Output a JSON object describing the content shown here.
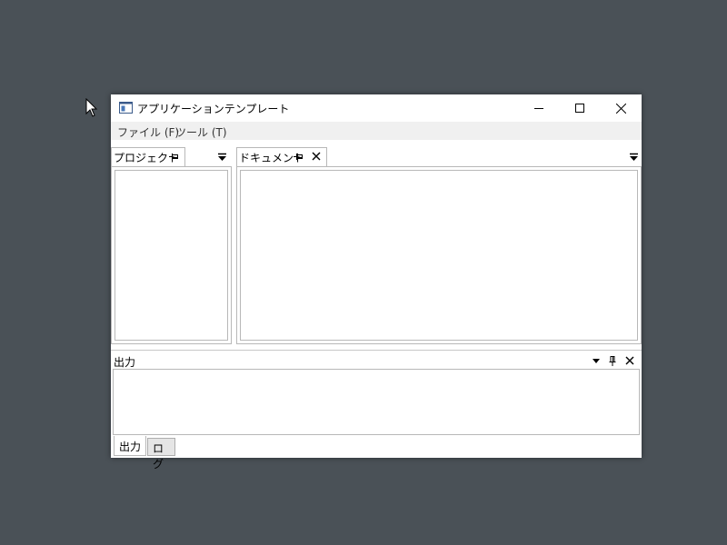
{
  "window": {
    "title": "アプリケーションテンプレート",
    "controls": {
      "minimize": "minimize-icon",
      "maximize": "maximize-icon",
      "close": "close-icon"
    }
  },
  "menubar": {
    "items": [
      {
        "label": "ファイル (F)"
      },
      {
        "label": "ツール (T)"
      }
    ]
  },
  "panes": {
    "project": {
      "tab_label": "プロジェクト",
      "icons": [
        "pin-icon",
        "dropdown-icon"
      ]
    },
    "document": {
      "tab_label": "ドキュメント",
      "icons": [
        "pin-icon",
        "close-icon",
        "dropdown-icon"
      ]
    },
    "output": {
      "title": "出力",
      "icons": [
        "dropdown-icon",
        "pin-icon",
        "close-icon"
      ]
    }
  },
  "bottom_tabs": [
    {
      "label": "出力",
      "active": true
    },
    {
      "label": "ログ",
      "active": false
    }
  ],
  "colors": {
    "desktop": "#4a5157",
    "window_bg": "#ffffff",
    "menubar_bg": "#f0f0f0",
    "border": "#b8b8b8"
  }
}
